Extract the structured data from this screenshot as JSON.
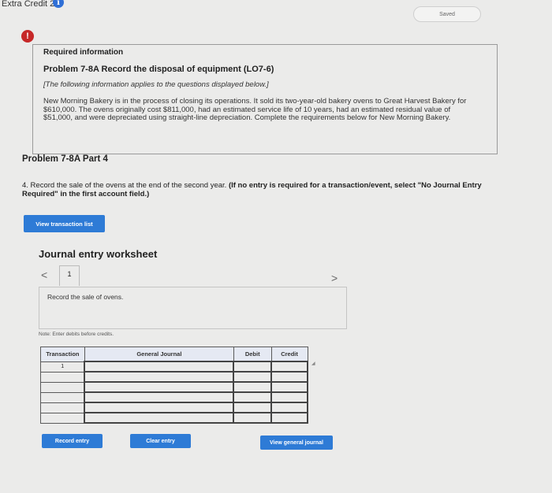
{
  "header": {
    "title": "Extra Credit 2",
    "info_icon": "i",
    "status": "Saved"
  },
  "alert": {
    "icon": "!"
  },
  "info": {
    "heading": "Required information",
    "problem_title": "Problem 7-8A Record the disposal of equipment (LO7-6)",
    "note": "[The following information applies to the questions displayed below.]",
    "paragraph": "New Morning Bakery is in the process of closing its operations. It sold its two-year-old bakery ovens to Great Harvest Bakery for $610,000. The ovens originally cost $811,000, had an estimated service life of 10 years, had an estimated residual value of $51,000, and were depreciated using straight-line depreciation. Complete the requirements below for New Morning Bakery."
  },
  "part": {
    "title": "Problem 7-8A Part 4",
    "instruction_plain": "4. Record the sale of the ovens at the end of the second year.",
    "instruction_bold": "(If no entry is required for a transaction/event, select \"No Journal Entry Required\" in the first account field.)"
  },
  "buttons": {
    "view_transaction_list": "View transaction list",
    "record_entry": "Record entry",
    "clear_entry": "Clear entry",
    "view_general_journal": "View general journal"
  },
  "worksheet": {
    "title": "Journal entry worksheet",
    "nav_prev": "<",
    "nav_next": ">",
    "page": "1",
    "description": "Record the sale of ovens.",
    "note": "Note: Enter debits before credits.",
    "columns": [
      "Transaction",
      "General Journal",
      "Debit",
      "Credit"
    ],
    "rows": [
      {
        "transaction": "1",
        "account": "",
        "debit": "",
        "credit": ""
      },
      {
        "transaction": "",
        "account": "",
        "debit": "",
        "credit": ""
      },
      {
        "transaction": "",
        "account": "",
        "debit": "",
        "credit": ""
      },
      {
        "transaction": "",
        "account": "",
        "debit": "",
        "credit": ""
      },
      {
        "transaction": "",
        "account": "",
        "debit": "",
        "credit": ""
      },
      {
        "transaction": "",
        "account": "",
        "debit": "",
        "credit": ""
      }
    ]
  },
  "colors": {
    "accent": "#2e7bd6",
    "alert": "#c62828",
    "background": "#ebebea"
  }
}
